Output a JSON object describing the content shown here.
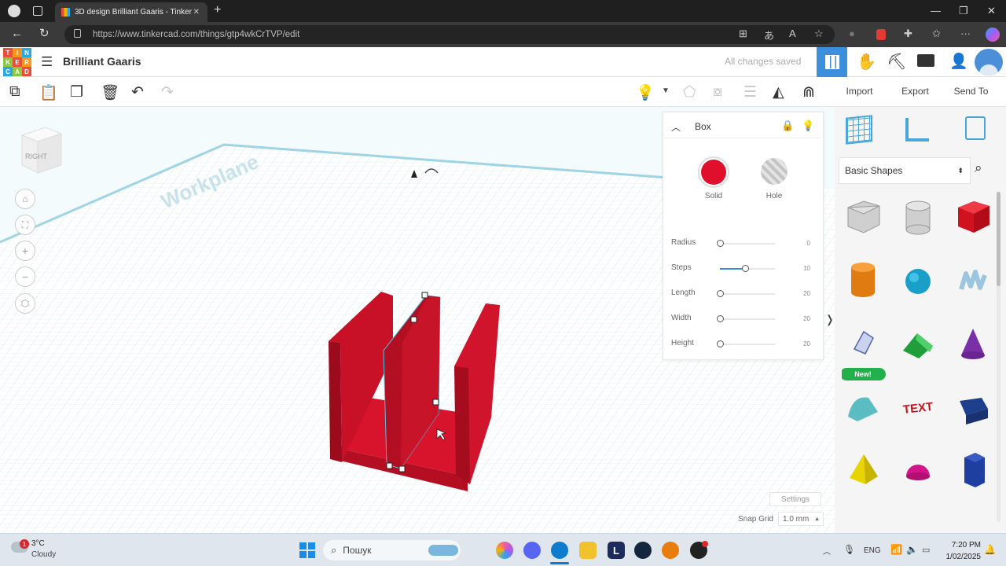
{
  "browser": {
    "tab_title": "3D design Brilliant Gaaris - Tinker",
    "url": "https://www.tinkercad.com/things/gtp4wkCrTVP/edit"
  },
  "header": {
    "design_name": "Brilliant Gaaris",
    "save_status": "All changes saved",
    "logo_letters": [
      "T",
      "I",
      "N",
      "K",
      "E",
      "R",
      "C",
      "A",
      "D"
    ]
  },
  "toolbar": {
    "import_label": "Import",
    "export_label": "Export",
    "send_to_label": "Send To"
  },
  "workplane": {
    "label": "Workplane",
    "view_cube_face": "RIGHT",
    "settings_label": "Settings",
    "snap_grid_label": "Snap Grid",
    "snap_grid_value": "1.0 mm"
  },
  "inspector": {
    "title": "Box",
    "solid_label": "Solid",
    "hole_label": "Hole",
    "solid_color": "#e0102c",
    "params": [
      {
        "name": "Radius",
        "value": "0",
        "level": 0.0
      },
      {
        "name": "Steps",
        "value": "10",
        "level": 0.45
      },
      {
        "name": "Length",
        "value": "20",
        "level": 0.0
      },
      {
        "name": "Width",
        "value": "20",
        "level": 0.0
      },
      {
        "name": "Height",
        "value": "20",
        "level": 0.0
      }
    ]
  },
  "shapes_panel": {
    "category": "Basic Shapes",
    "new_badge": "New!",
    "shapes": [
      "box-hole",
      "cylinder-hole",
      "box",
      "cylinder",
      "sphere",
      "scribble",
      "icon-shape",
      "roof",
      "cone",
      "round-roof",
      "text",
      "wedge",
      "pyramid",
      "half-sphere",
      "polygon"
    ]
  },
  "taskbar": {
    "weather_temp": "3°C",
    "weather_desc": "Cloudy",
    "weather_badge": "1",
    "search_placeholder": "Пошук",
    "lang": "ENG",
    "time": "7:20 PM",
    "date": "1/02/2025"
  }
}
